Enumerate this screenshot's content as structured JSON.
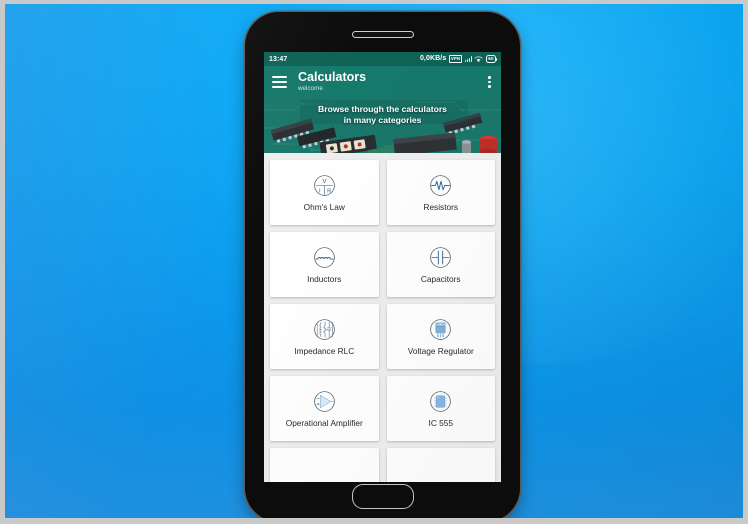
{
  "wallpaper": {
    "accent": "#0aa7f5"
  },
  "phone": {
    "speaker_name": "earpiece-speaker",
    "home_button_name": "home-button"
  },
  "status_bar": {
    "time": "13:47",
    "network_speed": "0,0KB/s",
    "vpn_label": "VPN",
    "battery_level": "60"
  },
  "app_bar": {
    "title": "Calculators",
    "subtitle": "welcome",
    "menu_icon": "hamburger-menu-icon",
    "overflow_icon": "overflow-menu-icon"
  },
  "banner": {
    "line1": "Browse through the calculators",
    "line2": "in many categories",
    "background": "circuit-board-photo"
  },
  "grid": {
    "items": [
      {
        "label": "Ohm's Law",
        "icon": "ohms-law-icon"
      },
      {
        "label": "Resistors",
        "icon": "resistor-icon"
      },
      {
        "label": "Inductors",
        "icon": "inductor-icon"
      },
      {
        "label": "Capacitors",
        "icon": "capacitor-icon"
      },
      {
        "label": "Impedance RLC",
        "icon": "impedance-rlc-icon"
      },
      {
        "label": "Voltage Regulator",
        "icon": "voltage-regulator-icon"
      },
      {
        "label": "Operational Amplifier",
        "icon": "op-amp-icon"
      },
      {
        "label": "IC 555",
        "icon": "ic-555-icon"
      }
    ],
    "ohms_law_symbols": {
      "top": "V",
      "left": "I",
      "right": "R"
    }
  },
  "colors": {
    "app_bar": "#15796b",
    "status_bar": "#0f6256",
    "card_bg": "#ffffff",
    "content_bg": "#eeeeee",
    "icon_stroke": "#4a5a63",
    "icon_blue": "#7fb4e0"
  }
}
